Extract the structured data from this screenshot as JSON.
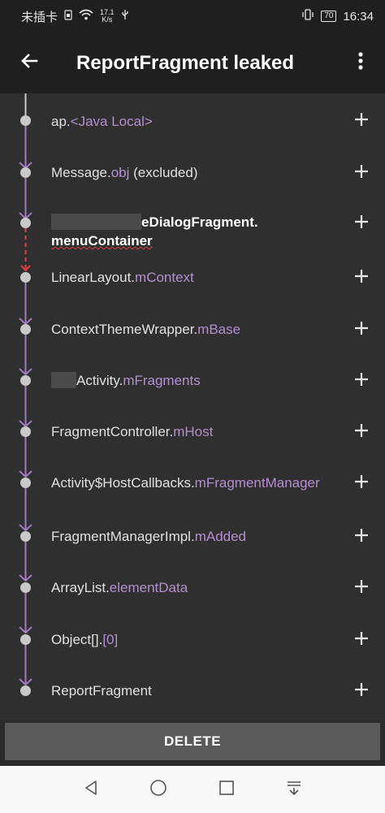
{
  "status_bar": {
    "carrier": "未插卡",
    "net_speed_value": "17.1",
    "net_speed_unit": "K/s",
    "battery": "70",
    "time": "16:34"
  },
  "app_bar": {
    "title": "ReportFragment leaked",
    "back_icon": "arrow-left-icon",
    "menu_icon": "more-vert-icon"
  },
  "trace": {
    "rows": [
      {
        "class": "ap.",
        "field": "<Java Local>",
        "suffix": ""
      },
      {
        "class": "Message.",
        "field": "obj",
        "suffix": " (excluded)"
      },
      {
        "class_visible": "eDialogFragment.",
        "field": "menuContainer"
      },
      {
        "class": "LinearLayout.",
        "field": "mContext",
        "suffix": ""
      },
      {
        "class": "ContextThemeWrapper.",
        "field": "mBase",
        "suffix": ""
      },
      {
        "class_visible": "Activity.",
        "field": "mFragments"
      },
      {
        "class": "FragmentController.",
        "field": "mHost",
        "suffix": ""
      },
      {
        "class": "Activity$HostCallbacks.",
        "field": "mFragmentManager",
        "suffix": ""
      },
      {
        "class": "FragmentManagerImpl.",
        "field": "mAdded",
        "suffix": ""
      },
      {
        "class": "ArrayList.",
        "field": "elementData",
        "suffix": ""
      },
      {
        "class": "Object[].",
        "field": "[0]",
        "suffix": ""
      },
      {
        "class": "ReportFragment",
        "field": "",
        "suffix": ""
      }
    ],
    "plus_icon": "plus-icon",
    "colors": {
      "line": "#a07bc0",
      "suspect_line": "#e04040",
      "field": "#b48fd0",
      "node": "#c9c9c9"
    }
  },
  "delete_button": {
    "label": "DELETE"
  },
  "nav_bar": {
    "icons": [
      "back-triangle-icon",
      "home-circle-icon",
      "recents-square-icon",
      "notification-pull-icon"
    ]
  }
}
